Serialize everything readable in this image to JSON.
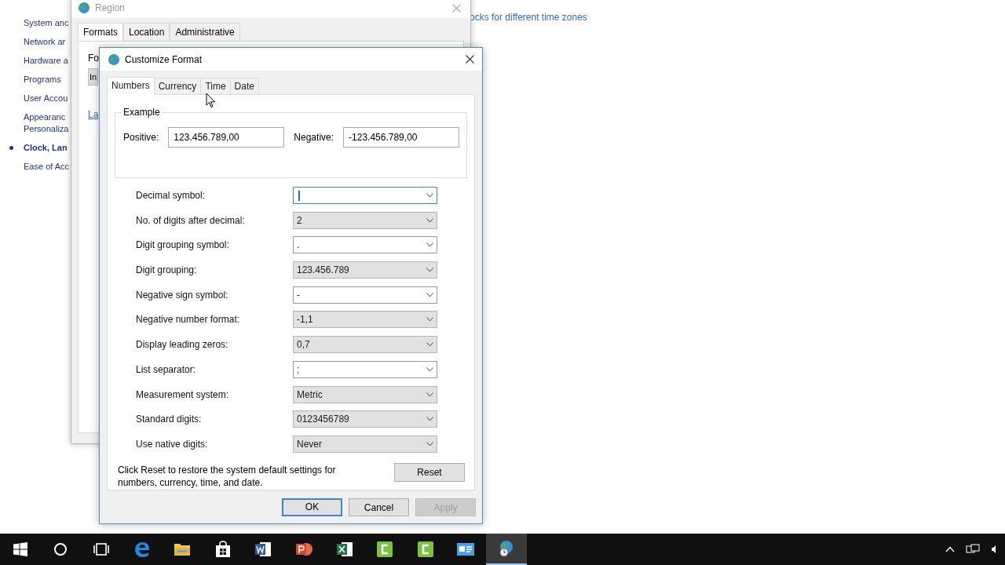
{
  "control_panel": {
    "sidebar_items": [
      {
        "label": "System anc",
        "selected": false
      },
      {
        "label": "Network ar",
        "selected": false
      },
      {
        "label": "Hardware a",
        "selected": false
      },
      {
        "label": "Programs",
        "selected": false
      },
      {
        "label": "User Accou",
        "selected": false
      },
      {
        "label": "Appearanc\nPersonaliza",
        "selected": false
      },
      {
        "label": "Clock, Lan",
        "selected": true
      },
      {
        "label": "Ease of Acc",
        "selected": false
      }
    ],
    "link": "ocks for different time zones"
  },
  "region_window": {
    "title": "Region",
    "tabs": [
      {
        "label": "Formats",
        "selected": true
      },
      {
        "label": "Location",
        "selected": false
      },
      {
        "label": "Administrative",
        "selected": false
      }
    ],
    "format_label": "Fo",
    "format_field": "In",
    "link": "La"
  },
  "customize_dialog": {
    "title": "Customize Format",
    "tabs": [
      {
        "label": "Numbers",
        "selected": true
      },
      {
        "label": "Currency",
        "selected": false
      },
      {
        "label": "Time",
        "selected": false
      },
      {
        "label": "Date",
        "selected": false
      }
    ],
    "example": {
      "title": "Example",
      "positive_label": "Positive:",
      "positive_value": "123.456.789,00",
      "negative_label": "Negative:",
      "negative_value": "-123.456.789,00"
    },
    "settings": [
      {
        "label": "Decimal symbol:",
        "kind": "editable",
        "focused": true
      },
      {
        "label": "No. of digits after decimal:",
        "kind": "list",
        "value": "2",
        "focused": false
      },
      {
        "label": "Digit grouping symbol:",
        "kind": "editable",
        "value": ".",
        "focused": false
      },
      {
        "label": "Digit grouping:",
        "kind": "list",
        "value": "123.456.789",
        "focused": false
      },
      {
        "label": "Negative sign symbol:",
        "kind": "editable",
        "value": "-",
        "focused": false
      },
      {
        "label": "Negative number format:",
        "kind": "list",
        "value": "-1,1",
        "focused": false
      },
      {
        "label": "Display leading zeros:",
        "kind": "list",
        "value": "0,7",
        "focused": false
      },
      {
        "label": "List separator:",
        "kind": "editable",
        "value": ";",
        "focused": false
      },
      {
        "label": "Measurement system:",
        "kind": "list",
        "value": "Metric",
        "focused": false
      },
      {
        "label": "Standard digits:",
        "kind": "list",
        "value": "0123456789",
        "focused": false
      },
      {
        "label": "Use native digits:",
        "kind": "list",
        "value": "Never",
        "focused": false
      }
    ],
    "reset_note": "Click Reset to restore the system default settings for numbers, currency, time, and date.",
    "reset_button": "Reset",
    "buttons": [
      {
        "label": "OK",
        "default": true,
        "disabled": false
      },
      {
        "label": "Cancel",
        "default": false,
        "disabled": false
      },
      {
        "label": "Apply",
        "default": false,
        "disabled": true
      }
    ]
  },
  "taskbar": {
    "apps": [
      {
        "kind": "start",
        "active": false
      },
      {
        "kind": "search",
        "active": false
      },
      {
        "kind": "taskview",
        "active": false
      },
      {
        "kind": "browser",
        "active": false
      },
      {
        "kind": "folder",
        "active": false
      },
      {
        "kind": "store",
        "active": false
      },
      {
        "kind": "doc",
        "active": false
      },
      {
        "kind": "slides",
        "active": false
      },
      {
        "kind": "sheet",
        "active": false
      },
      {
        "kind": "recorder",
        "active": false
      },
      {
        "kind": "recorder",
        "active": false
      },
      {
        "kind": "card",
        "active": false
      },
      {
        "kind": "globe",
        "active": true
      }
    ]
  }
}
